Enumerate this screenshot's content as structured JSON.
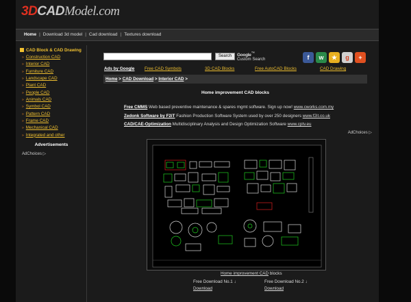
{
  "logo": {
    "part_3d": "3D",
    "part_cad": "CAD",
    "part_rest": "Model.com"
  },
  "topnav": {
    "home": "Home",
    "items": [
      "Download 3d model",
      "Cad download",
      "Textures download"
    ],
    "sep": "|"
  },
  "sidebar": {
    "heading": "CAD Block & CAD Drawing",
    "items": [
      "Construction CAD",
      "Interior CAD",
      "Furniture CAD",
      "Landscape CAD",
      "Plant CAD",
      "People CAD",
      "Animals CAD",
      "Symbol CAD",
      "Pattern CAD",
      "Frame CAD",
      "Mechanical CAD",
      "Integrated and other"
    ],
    "arrow": "»",
    "advertisements": "Advertisements",
    "adchoices": "AdChoices ▷"
  },
  "search": {
    "button": "Search",
    "google": "Google",
    "tm": "™",
    "custom": "Custom Search"
  },
  "social": {
    "fb": "f",
    "w": "w",
    "star": "★",
    "g": "g",
    "plus": "+"
  },
  "adlinks": {
    "ads_by": "Ads by Google",
    "links": [
      "Free CAD Symbols",
      "3D CAD Blocks",
      "Free AutoCAD Blocks",
      "CAD Drawing"
    ]
  },
  "breadcrumb": {
    "home": "Home",
    "gt": ">",
    "cad": "CAD Download",
    "interior": "Interior CAD"
  },
  "page_title": "Home improvement CAD blocks",
  "ads": [
    {
      "title": "Free CMMS",
      "text": "Web based preventive maintenance & spares mgmt software. Sign up now!",
      "url": "www.cworks.com.my"
    },
    {
      "title": "Zedonk Software by F2iT",
      "text": "Fashion Production Software System used by over 250 designers",
      "url": "www.f2it.co.uk"
    },
    {
      "title": "CAD/CAE-Optimization",
      "text": "Multidisciplinary Analysis and Design Optimization Software",
      "url": "www.cptv.eu"
    }
  ],
  "adchoices2": "AdChoices ▷",
  "caption": {
    "link": "Home improvement CAD",
    "rest": " blocks"
  },
  "downloads": [
    {
      "label": "Free Download No.1",
      "arrow": "↓",
      "link": "Download"
    },
    {
      "label": "Free Download No.2",
      "arrow": "↓",
      "link": "Download"
    }
  ],
  "colors": {
    "accent": "#f0c030",
    "logo_red": "#e03020",
    "cad_green": "#20d020",
    "cad_red": "#e02020"
  }
}
